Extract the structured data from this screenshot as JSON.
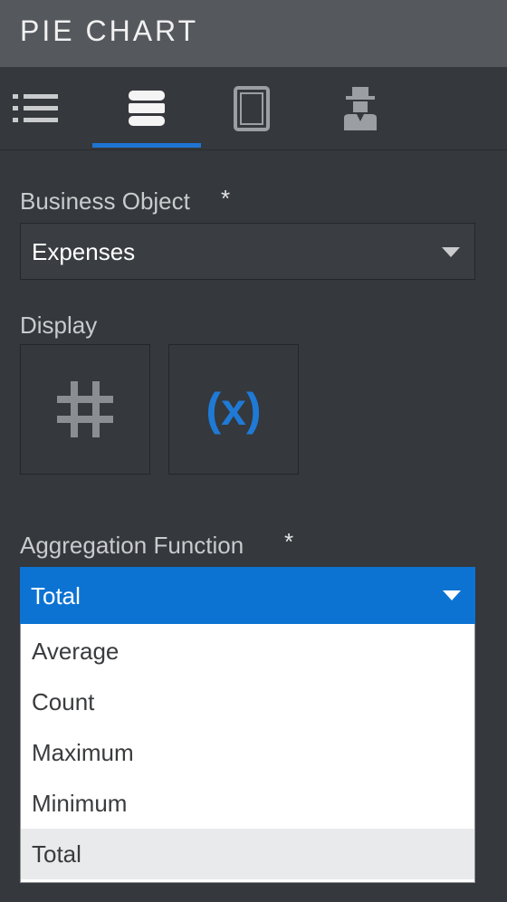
{
  "header": {
    "title": "PIE CHART"
  },
  "tabs": [
    {
      "icon": "list-icon"
    },
    {
      "icon": "database-icon",
      "active": true
    },
    {
      "icon": "tablet-icon"
    },
    {
      "icon": "user-icon"
    }
  ],
  "business_object": {
    "label": "Business Object",
    "required_mark": "*",
    "value": "Expenses"
  },
  "display": {
    "label": "Display",
    "options": [
      {
        "icon": "hash-icon"
      },
      {
        "icon": "expression-icon",
        "text": "(x)"
      }
    ]
  },
  "aggregation": {
    "label": "Aggregation Function",
    "required_mark": "*",
    "value": "Total",
    "options": [
      "Average",
      "Count",
      "Maximum",
      "Minimum",
      "Total"
    ],
    "highlighted": "Total"
  },
  "colors": {
    "header_bg": "#55585c",
    "panel_bg": "#35383c",
    "accent": "#0c73d2",
    "expression_blue": "#1f7ad6"
  }
}
